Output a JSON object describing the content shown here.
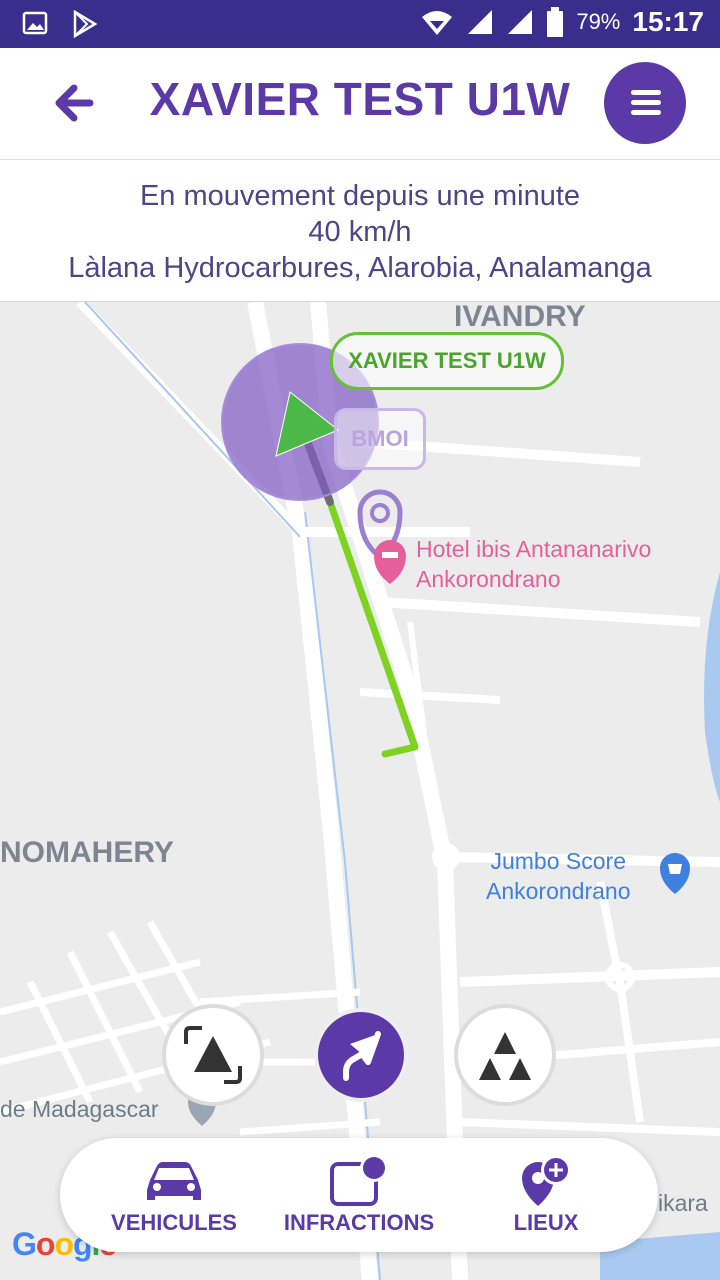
{
  "status_bar": {
    "battery_percent": "79%",
    "time": "15:17"
  },
  "header": {
    "title": "XAVIER TEST U1W"
  },
  "info": {
    "line1": "En mouvement depuis une minute",
    "line2": "40 km/h",
    "line3": "Làlana Hydrocarbures, Alarobia, Analamanga"
  },
  "map": {
    "area_ivandry": "IVANDRY",
    "area_nomahery": "NOMAHERY",
    "vehicle_tag": "XAVIER TEST U1W",
    "bmoi_label": "BMOI",
    "poi_hotel_line1": "Hotel ibis Antananarivo",
    "poi_hotel_line2": "Ankorondrano",
    "poi_jumbo_line1": "Jumbo Score",
    "poi_jumbo_line2": "Ankorondrano",
    "poi_madagascar": "de Madagascar",
    "poi_ikara": "ikara",
    "google_logo": "Google"
  },
  "bottom_nav": {
    "vehicules": "VEHICULES",
    "infractions": "INFRACTIONS",
    "lieux": "LIEUX"
  },
  "colors": {
    "brand": "#5b3aa8",
    "status_bar": "#3a2e8c",
    "route": "#7ed321",
    "vehicle": "#4cb848",
    "poi_pink": "#e5609a",
    "poi_blue": "#3f7fe0"
  }
}
